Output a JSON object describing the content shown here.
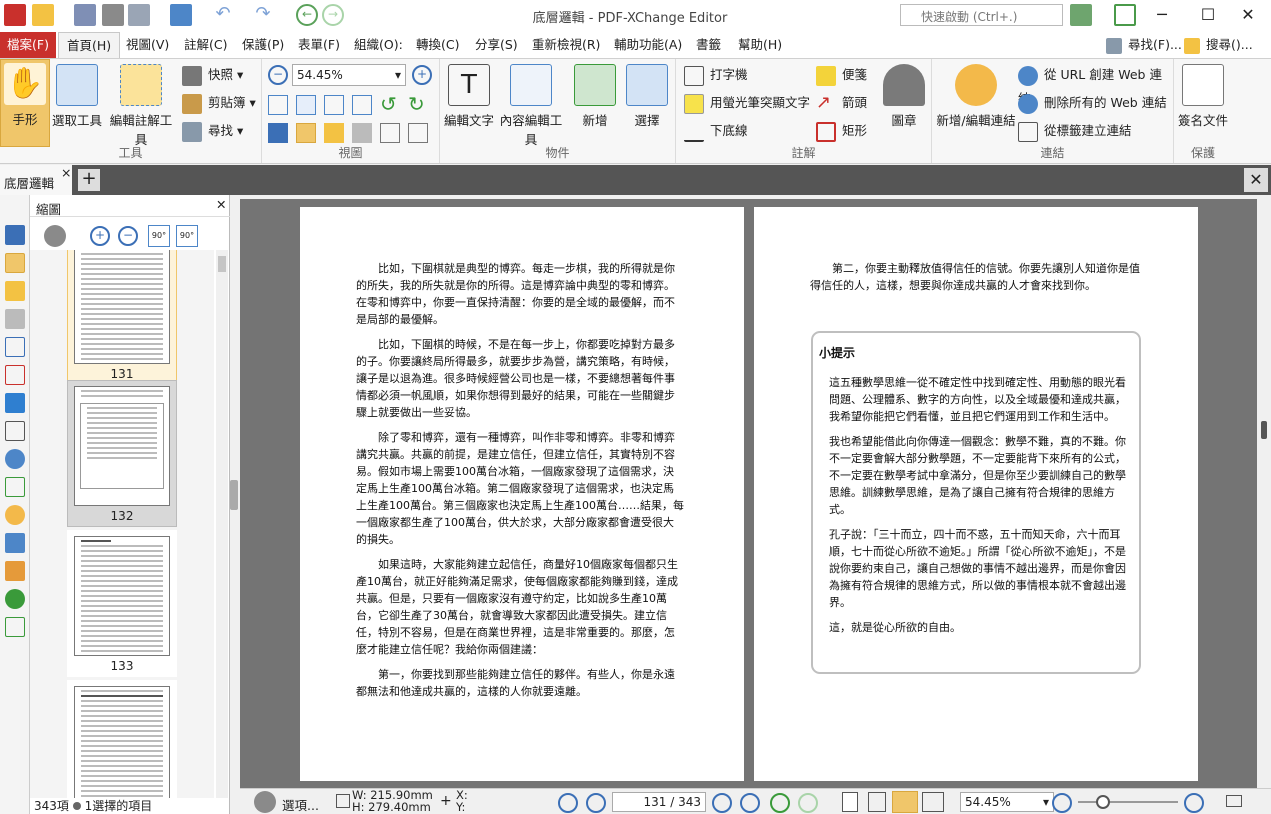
{
  "window": {
    "title": "底層邏輯 - PDF-XChange Editor",
    "search_placeholder": "快速啟動 (Ctrl+.)"
  },
  "menubar": {
    "items": [
      "檔案(F)",
      "首頁(H)",
      "視圖(V)",
      "註解(C)",
      "保護(P)",
      "表單(F)",
      "組織(O):",
      "轉換(C)",
      "分享(S)",
      "重新檢視(R)",
      "輔助功能(A)",
      "書籤",
      "幫助(H)"
    ],
    "find": "尋找(F)...",
    "search": "搜尋()..."
  },
  "ribbon": {
    "tools": {
      "label": "工具",
      "hand": "手形",
      "select": "選取工具",
      "edit_annot": "編輯註解工具",
      "snapshot": "快照",
      "clipboard": "剪貼簿",
      "find": "尋找"
    },
    "view": {
      "label": "視圖",
      "zoom": "54.45%"
    },
    "objects": {
      "label": "物件",
      "edit_text": "編輯文字",
      "edit_content": "內容編輯工具",
      "add": "新增",
      "select": "選擇"
    },
    "comment": {
      "label": "註解",
      "typewriter": "打字機",
      "highlight": "用螢光筆突顯文字",
      "underline": "下底線",
      "note": "便箋",
      "arrow": "箭頭",
      "rect": "矩形",
      "stamp": "圖章"
    },
    "links": {
      "label": "連結",
      "add_edit": "新增/編輯連結",
      "from_url": "從 URL 創建 Web 連結",
      "remove_all": "刪除所有的 Web 連結",
      "from_tag": "從標籤建立連結"
    },
    "protect": {
      "label": "保護",
      "sign": "簽名文件"
    }
  },
  "tabs": {
    "doc": "底層邏輯"
  },
  "panel": {
    "title": "縮圖",
    "thumbnails": [
      "131",
      "132",
      "133"
    ],
    "status_count": "343項",
    "status_selected": "1選擇的項目"
  },
  "page_left": {
    "paragraphs": [
      "比如，下圍棋就是典型的博弈。每走一步棋，我的所得就是你的所失，我的所失就是你的所得。這是博弈論中典型的零和博弈。在零和博弈中，你要一直保持清醒：你要的是全域的最優解，而不是局部的最優解。",
      "比如，下圍棋的時候，不是在每一步上，你都要吃掉對方最多的子。你要讓終局所得最多，就要步步為營，講究策略，有時候，讓子是以退為進。很多時候經營公司也是一樣，不要總想著每件事情都必須一帆風順，如果你想得到最好的結果，可能在一些關鍵步驟上就要做出一些妥協。",
      "除了零和博弈，還有一種博弈，叫作非零和博弈。非零和博弈講究共贏。共贏的前提，是建立信任，但建立信任，其實特別不容易。假如市場上需要100萬台冰箱，一個廠家發現了這個需求，決定馬上生產100萬台冰箱。第二個廠家發現了這個需求，也決定馬上生產100萬台。第三個廠家也決定馬上生產100萬台……結果，每一個廠家都生產了100萬台，供大於求，大部分廠家都會遭受很大的損失。",
      "如果這時，大家能夠建立起信任，商量好10個廠家每個都只生產10萬台，就正好能夠滿足需求，使每個廠家都能夠賺到錢，達成共贏。但是，只要有一個廠家沒有遵守約定，比如說多生產10萬台，它卻生產了30萬台，就會導致大家都因此遭受損失。建立信任，特別不容易，但是在商業世界裡，這是非常重要的。那麼，怎麼才能建立信任呢？我給你兩個建議：",
      "第一，你要找到那些能夠建立信任的夥伴。有些人，你是永遠都無法和他達成共贏的，這樣的人你就要遠離。"
    ]
  },
  "page_right": {
    "intro": "第二，你要主動釋放值得信任的信號。你要先讓別人知道你是值得信任的人，這樣，想要與你達成共贏的人才會來找到你。",
    "tip_title": "小提示",
    "tip_paragraphs": [
      "這五種數學思維一從不確定性中找到確定性、用動態的眼光看問題、公理體系、數字的方向性，以及全域最優和達成共贏，我希望你能把它們看懂，並且把它們運用到工作和生活中。",
      "我也希望能借此向你傳達一個觀念：數學不難，真的不難。你不一定要會解大部分數學題，不一定要能背下來所有的公式，不一定要在數學考試中拿滿分，但是你至少要訓練自己的數學思維。訓練數學思維，是為了讓自己擁有符合規律的思維方式。",
      "孔子說：「三十而立，四十而不惑，五十而知天命，六十而耳順，七十而從心所欲不逾矩。」所謂「從心所欲不逾矩」，不是說你要約束自己，讓自己想做的事情不越出邊界，而是你會因為擁有符合規律的思維方式，所以做的事情根本就不會越出邊界。",
      "這，就是從心所欲的自由。"
    ]
  },
  "statusbar": {
    "options": "選項...",
    "width": "W: 215.90mm",
    "height": "H: 279.40mm",
    "x": "X:",
    "y": "Y:",
    "page_current": "131",
    "page_total": "343",
    "zoom": "54.45%"
  }
}
